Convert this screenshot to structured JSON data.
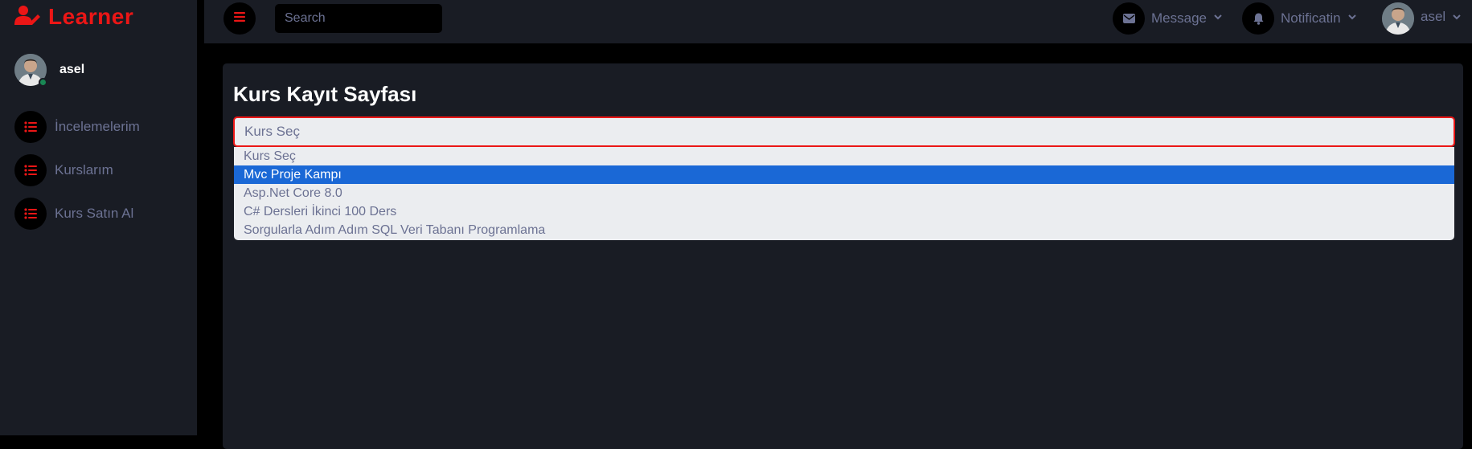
{
  "brand": {
    "name": "Learner",
    "color": "#eb1616",
    "icon": "user-edit-icon"
  },
  "sidebar": {
    "user": {
      "name": "asel",
      "status": "online"
    },
    "items": [
      {
        "label": "İncelemelerim",
        "icon": "list-icon"
      },
      {
        "label": "Kurslarım",
        "icon": "list-icon"
      },
      {
        "label": "Kurs Satın Al",
        "icon": "list-icon"
      }
    ]
  },
  "topbar": {
    "menu_icon": "bars-icon",
    "search": {
      "placeholder": "Search",
      "value": ""
    },
    "message_label": "Message",
    "notification_label": "Notificatin",
    "user_label": "asel"
  },
  "main": {
    "title": "Kurs Kayıt Sayfası",
    "select": {
      "value": "Kurs Seç",
      "options": [
        {
          "label": "Kurs Seç",
          "selected": false
        },
        {
          "label": "Mvc Proje Kampı",
          "selected": true
        },
        {
          "label": "Asp.Net Core 8.0",
          "selected": false
        },
        {
          "label": "C# Dersleri İkinci 100 Ders",
          "selected": false
        },
        {
          "label": "Sorgularla Adım Adım SQL Veri Tabanı Programlama",
          "selected": false
        }
      ]
    }
  },
  "colors": {
    "primary": "#eb1616",
    "secondary": "#191c24",
    "light": "#6c7293",
    "highlight": "#1a68d6",
    "online": "#198754"
  }
}
